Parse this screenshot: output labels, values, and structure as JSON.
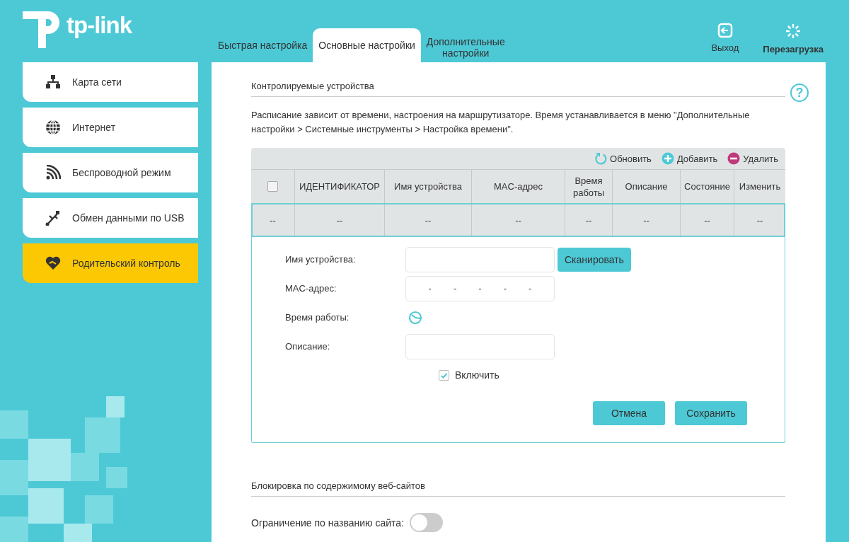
{
  "logo": "tp-link",
  "tabs": [
    {
      "label": "Быстрая настройка",
      "selected": false
    },
    {
      "label": "Основные настройки",
      "selected": true
    },
    {
      "label": "Дополнительные настройки",
      "selected": false
    }
  ],
  "header_actions": [
    {
      "kind": "logout",
      "label": "Выход"
    },
    {
      "kind": "reboot",
      "label": "Перезагрузка"
    }
  ],
  "sidebar": {
    "items": [
      {
        "kind": "network-map",
        "label": "Карта сети",
        "selected": false
      },
      {
        "kind": "internet",
        "label": "Интернет",
        "selected": false
      },
      {
        "kind": "wireless",
        "label": "Беспроводной режим",
        "selected": false
      },
      {
        "kind": "usb",
        "label": "Обмен данными по USB",
        "selected": false
      },
      {
        "kind": "parental",
        "label": "Родительский контроль",
        "selected": true
      }
    ]
  },
  "controlled_devices": {
    "title": "Контролируемые устройства",
    "help": "?",
    "note": "Расписание зависит от времени, настроения на маршрутизаторе. Время устанавливается в меню \"Дополнительные настройки > Системные инструменты > Настройка времени\".",
    "toolbar": [
      {
        "kind": "refresh",
        "label": "Обновить"
      },
      {
        "kind": "add",
        "label": "Добавить"
      },
      {
        "kind": "delete",
        "label": "Удалить"
      }
    ],
    "table": {
      "columns": [
        {
          "kind": "select",
          "checked": false
        },
        {
          "kind": "text",
          "label": "ИДЕНТИФИКАТОР"
        },
        {
          "kind": "text",
          "label": "Имя устройства"
        },
        {
          "kind": "text",
          "label": "MAC-адрес"
        },
        {
          "kind": "text",
          "label": "Время работы"
        },
        {
          "kind": "text",
          "label": "Описание"
        },
        {
          "kind": "text",
          "label": "Состояние"
        },
        {
          "kind": "text",
          "label": "Изменить"
        }
      ],
      "rows": [
        {
          "selected": true,
          "cells": [
            "--",
            "--",
            "--",
            "--",
            "--",
            "--",
            "--",
            "--"
          ]
        }
      ]
    },
    "form": {
      "fields": [
        {
          "kind": "text",
          "label": "Имя устройства:",
          "button": "Сканировать"
        },
        {
          "kind": "mac",
          "label": "MAC-адрес:",
          "separators": [
            "-",
            "-",
            "-",
            "-",
            "-"
          ]
        },
        {
          "kind": "schedule",
          "label": "Время работы:"
        },
        {
          "kind": "text",
          "label": "Описание:"
        }
      ],
      "enable": {
        "label": "Включить",
        "checked": true
      },
      "buttons": [
        "Отмена",
        "Сохранить"
      ]
    }
  },
  "content_blocking": {
    "title": "Блокировка по содержимому веб-сайтов",
    "toggle": {
      "label": "Ограничение по названию сайта:",
      "on": false
    }
  }
}
